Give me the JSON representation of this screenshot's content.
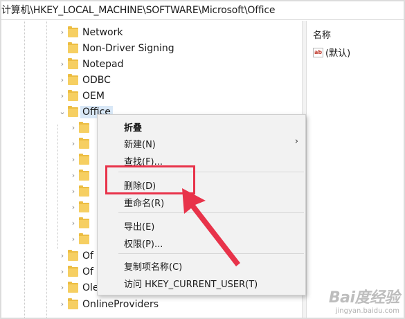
{
  "address_bar": {
    "path": "计算机\\HKEY_LOCAL_MACHINE\\SOFTWARE\\Microsoft\\Office"
  },
  "tree": {
    "nodes": [
      {
        "label": "Network"
      },
      {
        "label": "Non-Driver Signing"
      },
      {
        "label": "Notepad"
      },
      {
        "label": "ODBC"
      },
      {
        "label": "OEM"
      },
      {
        "label": "Office",
        "expanded": true,
        "selected": true
      },
      {
        "label": "Of"
      },
      {
        "label": "Of"
      },
      {
        "label": "Ole"
      },
      {
        "label": "OnlineProviders"
      }
    ]
  },
  "values_pane": {
    "column_header": "名称",
    "rows": [
      {
        "icon": "string-value-icon",
        "name": "(默认)"
      }
    ]
  },
  "context_menu": {
    "items": [
      {
        "label": "折叠",
        "bold": true
      },
      {
        "label": "新建(N)",
        "has_submenu": true
      },
      {
        "label": "查找(F)..."
      },
      {
        "label": "删除(D)",
        "highlighted": true
      },
      {
        "label": "重命名(R)"
      },
      {
        "label": "导出(E)"
      },
      {
        "label": "权限(P)..."
      },
      {
        "label": "复制项名称(C)"
      },
      {
        "label": "访问 HKEY_CURRENT_USER(T)"
      }
    ]
  },
  "annotation": {
    "box_color": "#e8334a",
    "arrow_color": "#e8334a"
  },
  "watermark": {
    "main": "Bai度经验",
    "sub": "jingyan.baidu.com"
  }
}
